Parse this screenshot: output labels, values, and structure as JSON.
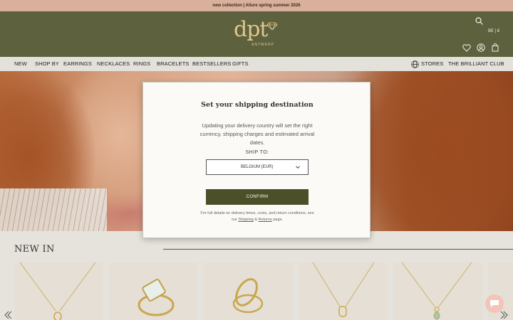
{
  "announcement": "new collection | Allure spring summer 2026",
  "brand": {
    "logo_text": "dpt",
    "logo_sub": "ANTWERP"
  },
  "header": {
    "locale": "BE | €"
  },
  "nav": {
    "items": [
      "NEW",
      "SHOP BY",
      "EARRINGS",
      "NECKLACES",
      "RINGS",
      "BRACELETS",
      "BESTSELLERS",
      "GIFTS"
    ],
    "stores": "STORES",
    "club": "THE BRILLIANT CLUB"
  },
  "modal": {
    "title": "Set your shipping destination",
    "description": "Updating your delivery country will set the right currency, shipping charges and estimated arrival dates.",
    "ship_to_label": "SHIP TO:",
    "selected_country": "BELGIUM (EUR)",
    "confirm_label": "CONFIRM",
    "footer_prefix": "For full details on delivery times, costs, and return conditions, see our",
    "footer_link1": "Shipping",
    "footer_amp": "&",
    "footer_link2": "Returns",
    "footer_suffix": "page."
  },
  "section": {
    "title": "NEW IN"
  },
  "colors": {
    "header_bg": "#5d613d",
    "announce_bg": "#d9b09b",
    "confirm_bg": "#4c5028",
    "logo_gold": "#e2c68d"
  },
  "icons": [
    "search-icon",
    "heart-icon",
    "account-icon",
    "bag-icon",
    "globe-icon",
    "chevron-down-icon",
    "chat-icon",
    "arrow-left-icon",
    "arrow-right-icon"
  ]
}
